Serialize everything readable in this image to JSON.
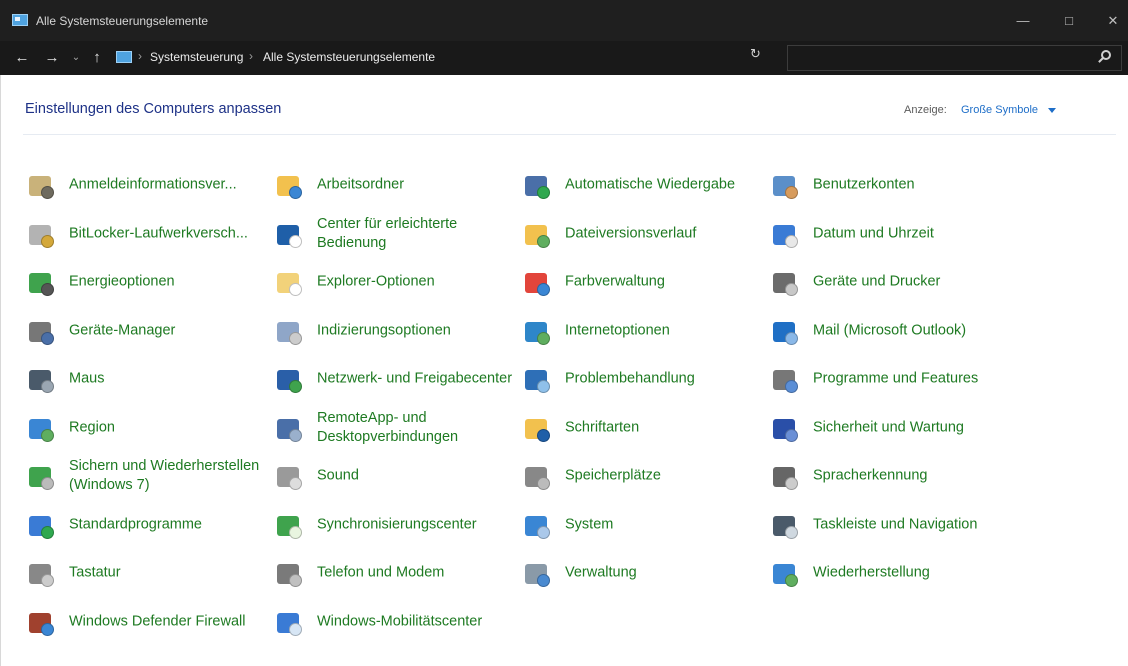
{
  "window": {
    "title": "Alle Systemsteuerungselemente",
    "minimize_icon": "minimize-icon",
    "maximize_icon": "maximize-icon",
    "close_icon": "close-icon"
  },
  "address_bar": {
    "breadcrumbs": [
      "Systemsteuerung",
      "Alle Systemsteuerungselemente"
    ],
    "separator": "›",
    "search_placeholder": ""
  },
  "nav": {
    "back": "←",
    "forward": "→",
    "recent": "⌄",
    "up": "↑",
    "refresh": "↻"
  },
  "content": {
    "title": "Einstellungen des Computers anpassen",
    "view_label": "Anzeige:",
    "view_value": "Große Symbole"
  },
  "colors": {
    "link_green": "#1e7a22",
    "title_blue": "#1e3287",
    "accent_blue": "#1e6ec8",
    "titlebar": "#1f1f1f"
  },
  "items": [
    {
      "label": "Anmeldeinformationsver...",
      "icon": "credential-vault-icon"
    },
    {
      "label": "Arbeitsordner",
      "icon": "work-folders-icon"
    },
    {
      "label": "Automatische Wiedergabe",
      "icon": "autoplay-icon"
    },
    {
      "label": "Benutzerkonten",
      "icon": "user-accounts-icon"
    },
    {
      "label": "BitLocker-Laufwerkversch...",
      "icon": "bitlocker-icon"
    },
    {
      "label": "Center für erleichterte Bedienung",
      "icon": "ease-of-access-icon"
    },
    {
      "label": "Dateiversionsverlauf",
      "icon": "file-history-icon"
    },
    {
      "label": "Datum und Uhrzeit",
      "icon": "date-time-icon"
    },
    {
      "label": "Energieoptionen",
      "icon": "power-options-icon"
    },
    {
      "label": "Explorer-Optionen",
      "icon": "explorer-options-icon"
    },
    {
      "label": "Farbverwaltung",
      "icon": "color-management-icon"
    },
    {
      "label": "Geräte und Drucker",
      "icon": "devices-printers-icon"
    },
    {
      "label": "Geräte-Manager",
      "icon": "device-manager-icon"
    },
    {
      "label": "Indizierungsoptionen",
      "icon": "indexing-options-icon"
    },
    {
      "label": "Internetoptionen",
      "icon": "internet-options-icon"
    },
    {
      "label": "Mail (Microsoft Outlook)",
      "icon": "mail-icon"
    },
    {
      "label": "Maus",
      "icon": "mouse-icon"
    },
    {
      "label": "Netzwerk- und Freigabecenter",
      "icon": "network-sharing-icon"
    },
    {
      "label": "Problembehandlung",
      "icon": "troubleshooting-icon"
    },
    {
      "label": "Programme und Features",
      "icon": "programs-features-icon"
    },
    {
      "label": "Region",
      "icon": "region-icon"
    },
    {
      "label": "RemoteApp- und Desktopverbindungen",
      "icon": "remoteapp-icon"
    },
    {
      "label": "Schriftarten",
      "icon": "fonts-icon"
    },
    {
      "label": "Sicherheit und Wartung",
      "icon": "security-maintenance-icon"
    },
    {
      "label": "Sichern und Wiederherstellen (Windows 7)",
      "icon": "backup-restore-icon"
    },
    {
      "label": "Sound",
      "icon": "sound-icon"
    },
    {
      "label": "Speicherplätze",
      "icon": "storage-spaces-icon"
    },
    {
      "label": "Spracherkennung",
      "icon": "speech-recognition-icon"
    },
    {
      "label": "Standardprogramme",
      "icon": "default-programs-icon"
    },
    {
      "label": "Synchronisierungscenter",
      "icon": "sync-center-icon"
    },
    {
      "label": "System",
      "icon": "system-icon"
    },
    {
      "label": "Taskleiste und Navigation",
      "icon": "taskbar-navigation-icon"
    },
    {
      "label": "Tastatur",
      "icon": "keyboard-icon"
    },
    {
      "label": "Telefon und Modem",
      "icon": "phone-modem-icon"
    },
    {
      "label": "Verwaltung",
      "icon": "administrative-tools-icon"
    },
    {
      "label": "Wiederherstellung",
      "icon": "recovery-icon"
    },
    {
      "label": "Windows Defender Firewall",
      "icon": "firewall-icon"
    },
    {
      "label": "Windows-Mobilitätscenter",
      "icon": "mobility-center-icon"
    }
  ]
}
